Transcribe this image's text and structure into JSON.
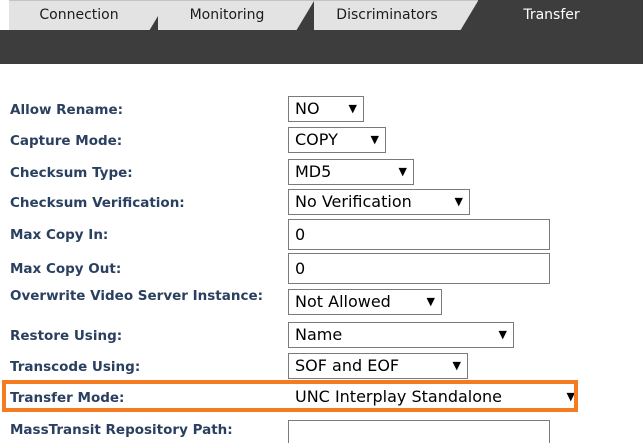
{
  "tabs": {
    "connection": "Connection",
    "monitoring": "Monitoring",
    "discriminators": "Discriminators",
    "transfer": "Transfer",
    "active": "Transfer"
  },
  "settings": {
    "allow_rename": {
      "label": "Allow Rename:",
      "value": "NO"
    },
    "capture_mode": {
      "label": "Capture Mode:",
      "value": "COPY"
    },
    "checksum_type": {
      "label": "Checksum Type:",
      "value": "MD5"
    },
    "checksum_verification": {
      "label": "Checksum Verification:",
      "value": "No Verification"
    },
    "max_copy_in": {
      "label": "Max Copy In:",
      "value": "0"
    },
    "max_copy_out": {
      "label": "Max Copy Out:",
      "value": "0"
    },
    "overwrite_video_server": {
      "label": "Overwrite Video Server Instance:",
      "value": "Not Allowed"
    },
    "restore_using": {
      "label": "Restore Using:",
      "value": "Name"
    },
    "transcode_using": {
      "label": "Transcode Using:",
      "value": "SOF and EOF"
    },
    "transfer_mode": {
      "label": "Transfer Mode:",
      "value": "UNC Interplay Standalone"
    },
    "masstransit_path": {
      "label": "MassTransit Repository Path:",
      "value": ""
    }
  },
  "icons": {
    "dropdown_arrow": "chevron-down-icon"
  },
  "colors": {
    "tab_bar": "#3d3d3d",
    "tab_inactive": "#e3e3e3",
    "label_text": "#2a4060",
    "highlight": "#f47b20"
  }
}
